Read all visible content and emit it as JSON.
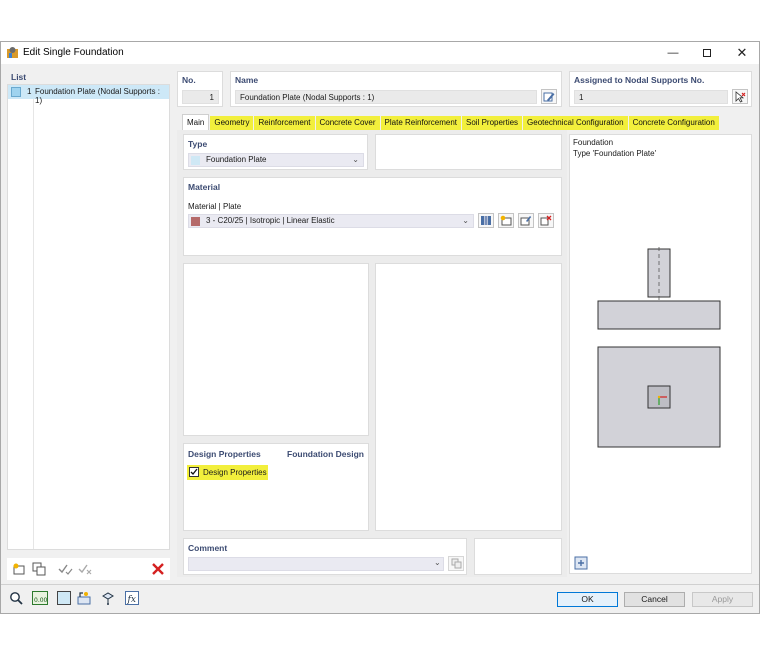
{
  "window": {
    "title": "Edit Single Foundation"
  },
  "list": {
    "header": "List",
    "items": [
      {
        "no": "1",
        "label": "Foundation Plate (Nodal Supports : 1)"
      }
    ]
  },
  "fields": {
    "no_label": "No.",
    "no_value": "1",
    "name_label": "Name",
    "name_value": "Foundation Plate (Nodal Supports : 1)",
    "assigned_label": "Assigned to Nodal Supports No.",
    "assigned_value": "1"
  },
  "tabs": [
    "Main",
    "Geometry",
    "Reinforcement",
    "Concrete Cover",
    "Plate Reinforcement",
    "Soil Properties",
    "Geotechnical Configuration",
    "Concrete Configuration"
  ],
  "type": {
    "header": "Type",
    "value": "Foundation Plate",
    "color": "#cfe8f5"
  },
  "material": {
    "header": "Material",
    "label": "Material | Plate",
    "value": "3 - C20/25 | Isotropic | Linear Elastic",
    "color": "#b56a6a"
  },
  "design": {
    "header": "Design Properties",
    "header_right": "Foundation Design",
    "checkbox_label": "Design Properties",
    "checked": true
  },
  "comment": {
    "header": "Comment",
    "value": ""
  },
  "preview": {
    "line1": "Foundation",
    "line2": "Type 'Foundation Plate'"
  },
  "buttons": {
    "ok": "OK",
    "cancel": "Cancel",
    "apply": "Apply"
  },
  "colors": {
    "accent": "#3c4b72",
    "highlight": "#f2ef3c",
    "ok_border": "#0078d7",
    "delete": "#d42020"
  }
}
